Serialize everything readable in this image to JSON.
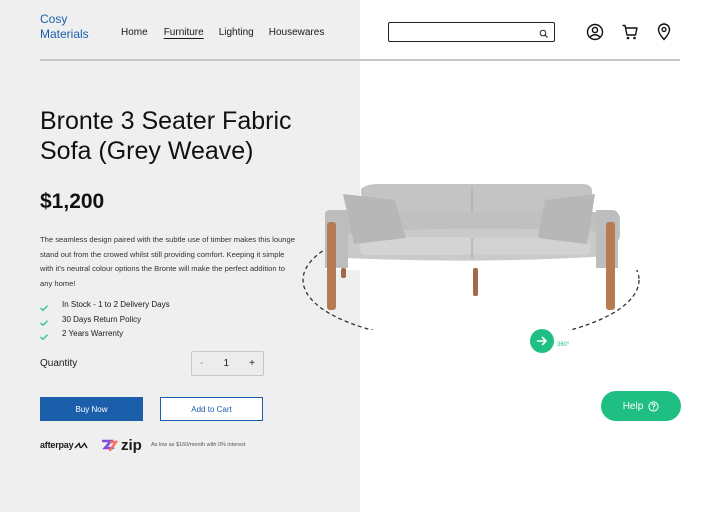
{
  "brand": {
    "line1": "Cosy",
    "line2": "Materials",
    "color": "#1b5fab"
  },
  "nav": {
    "items": [
      {
        "label": "Home",
        "active": false
      },
      {
        "label": "Furniture",
        "active": true
      },
      {
        "label": "Lighting",
        "active": false
      },
      {
        "label": "Housewares",
        "active": false
      }
    ]
  },
  "search": {
    "value": "",
    "placeholder": "",
    "icon": "search-icon"
  },
  "header_icons": [
    "account-icon",
    "cart-icon",
    "location-icon"
  ],
  "product": {
    "title": "Bronte 3 Seater Fabric Sofa (Grey Weave)",
    "price": "$1,200",
    "description": "The seamless design paired with the subtle use of timber makes this lounge stand out from the crowed whilst still providing comfort. Keeping it simple with it's neutral colour options the Bronte will make the perfect addition to any home!",
    "features": [
      "In Stock - 1 to 2 Delivery Days",
      "30 Days Return Policy",
      "2 Years Warrenty"
    ],
    "quantity_label": "Quantity",
    "quantity": "1",
    "minus": "-",
    "plus": "+",
    "buy_label": "Buy Now",
    "cart_label": "Add to Cart"
  },
  "payment": {
    "afterpay": "afterpay",
    "zip": "zip",
    "installment_text": "As low as $160/month with 0% interest"
  },
  "viewer": {
    "rotation_label": "360°"
  },
  "help": {
    "label": "Help"
  },
  "colors": {
    "accent": "#1fbf84",
    "brand_blue": "#1b5fab",
    "left_panel": "#efefef"
  }
}
